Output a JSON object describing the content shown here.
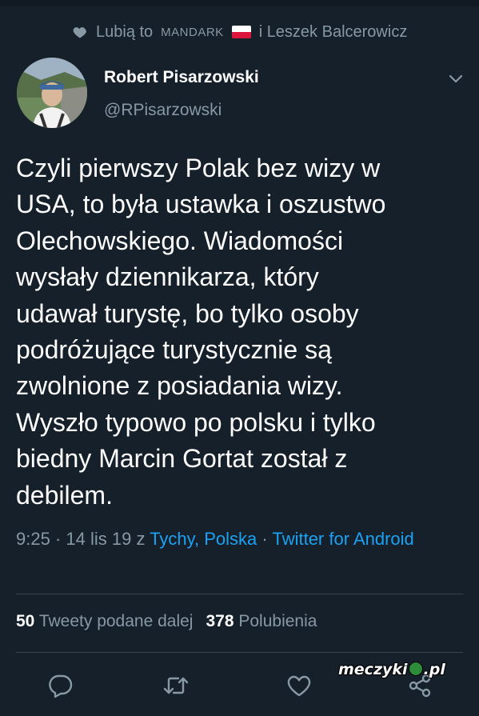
{
  "liked_by": {
    "prefix": "Lubią to",
    "user1": "MANDARK",
    "connector": "i Leszek Balcerowicz",
    "flag_colors": [
      "#ffffff",
      "#dc143c"
    ]
  },
  "author": {
    "name": "Robert Pisarzowski",
    "handle": "@RPisarzowski"
  },
  "tweet": {
    "text": "Czyli pierwszy Polak bez wizy w\nUSA, to była ustawka i oszustwo\nOlechowskiego. Wiadomości\nwysłały dziennikarza, który\nudawał turystę, bo tylko osoby\npodróżujące turystycznie są\nzwolnione z posiadania wizy.\nWyszło typowo po polsku i tylko\nbiedny Marcin Gortat został z\ndebilem."
  },
  "meta": {
    "time": "9:25",
    "sep1": "·",
    "date": "14 lis 19",
    "z": "z",
    "location": "Tychy, Polska",
    "sep2": "·",
    "client": "Twitter for Android"
  },
  "stats": {
    "retweets_count": "50",
    "retweets_label": "Tweety podane dalej",
    "likes_count": "378",
    "likes_label": "Polubienia"
  },
  "actions": {
    "icons": [
      "reply-icon",
      "retweet-icon",
      "like-icon",
      "share-icon"
    ]
  },
  "watermark": {
    "left": "meczyki",
    "right": ".pl"
  },
  "colors": {
    "background": "#15202b",
    "text": "#ffffff",
    "muted": "#8899a6",
    "link": "#1da1f2",
    "divider": "#38444d"
  }
}
